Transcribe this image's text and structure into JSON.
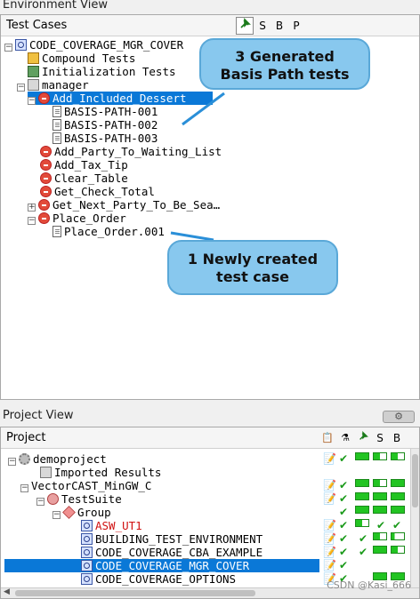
{
  "env_view": {
    "title": "Environment View",
    "header": "Test Cases",
    "col_s": "S",
    "col_b": "B",
    "col_p": "P",
    "tree": [
      {
        "label": "CODE_COVERAGE_MGR_COVER"
      },
      {
        "label": "Compound Tests"
      },
      {
        "label": "Initialization Tests"
      },
      {
        "label": "manager"
      },
      {
        "label": "Add_Included_Dessert"
      },
      {
        "label": "BASIS-PATH-001"
      },
      {
        "label": "BASIS-PATH-002"
      },
      {
        "label": "BASIS-PATH-003"
      },
      {
        "label": "Add_Party_To_Waiting_List"
      },
      {
        "label": "Add_Tax_Tip"
      },
      {
        "label": "Clear_Table"
      },
      {
        "label": "Get_Check_Total"
      },
      {
        "label": "Get_Next_Party_To_Be_Sea…"
      },
      {
        "label": "Place_Order"
      },
      {
        "label": "Place_Order.001"
      }
    ],
    "callouts": {
      "basis": "3 Generated Basis Path tests",
      "new": "1 Newly created test case"
    }
  },
  "project_view": {
    "title": "Project View",
    "header": "Project",
    "col_s": "S",
    "col_b": "B",
    "tree": [
      {
        "label": "demoproject"
      },
      {
        "label": "Imported Results"
      },
      {
        "label": "VectorCAST_MinGW_C"
      },
      {
        "label": "TestSuite"
      },
      {
        "label": "Group"
      },
      {
        "label": "ASW_UT1"
      },
      {
        "label": "BUILDING_TEST_ENVIRONMENT"
      },
      {
        "label": "CODE_COVERAGE_CBA_EXAMPLE"
      },
      {
        "label": "CODE_COVERAGE_MGR_COVER"
      },
      {
        "label": "CODE_COVERAGE_OPTIONS"
      }
    ]
  },
  "watermark": "CSDN @Kasi_666",
  "colors": {
    "selection": "#0a78d7",
    "callout": "#88c8ee",
    "error_text": "#d01010",
    "coverage": "#22c422"
  }
}
